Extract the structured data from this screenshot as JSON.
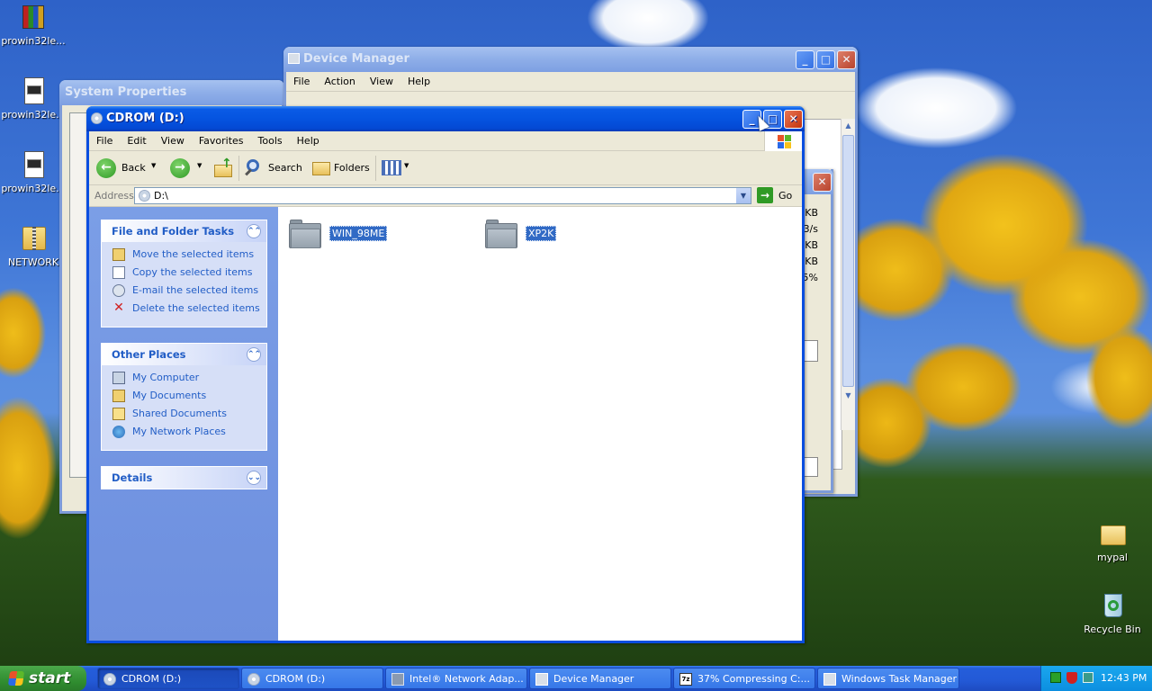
{
  "desktop": {
    "icons": [
      {
        "label": "prowin32le..."
      },
      {
        "label": "prowin32le..."
      },
      {
        "label": "prowin32le..."
      },
      {
        "label": "NETWORK"
      },
      {
        "label": "mypal"
      },
      {
        "label": "Recycle Bin"
      }
    ]
  },
  "system_properties": {
    "title": "System Properties"
  },
  "device_manager": {
    "title": "Device Manager",
    "menu": [
      "File",
      "Action",
      "View",
      "Help"
    ]
  },
  "background_dialog": {
    "stats": [
      "KB",
      "3/s",
      "KB",
      "KB",
      "5%"
    ]
  },
  "explorer": {
    "title": "CDROM (D:)",
    "menu": [
      "File",
      "Edit",
      "View",
      "Favorites",
      "Tools",
      "Help"
    ],
    "toolbar": {
      "back": "Back",
      "search": "Search",
      "folders": "Folders"
    },
    "address_label": "Address",
    "address_value": "D:\\",
    "go_label": "Go",
    "file_tasks": {
      "title": "File and Folder Tasks",
      "items": [
        "Move the selected items",
        "Copy the selected items",
        "E-mail the selected items",
        "Delete the selected items"
      ]
    },
    "other_places": {
      "title": "Other Places",
      "items": [
        "My Computer",
        "My Documents",
        "Shared Documents",
        "My Network Places"
      ]
    },
    "details": {
      "title": "Details"
    },
    "files": [
      {
        "name": "WIN_98ME",
        "selected": true
      },
      {
        "name": "XP2K",
        "selected": true
      }
    ]
  },
  "taskbar": {
    "start_label": "start",
    "items": [
      {
        "label": "CDROM (D:)",
        "active": true
      },
      {
        "label": "CDROM (D:)",
        "active": false
      },
      {
        "label": "Intel® Network Adap...",
        "active": false
      },
      {
        "label": "Device Manager",
        "active": false
      },
      {
        "label": "37% Compressing C:...",
        "active": false
      },
      {
        "label": "Windows Task Manager",
        "active": false
      }
    ],
    "clock": "12:43 PM"
  },
  "colors": {
    "title_blue": "#0554e0",
    "task_pane": "#6d8fdf",
    "link_blue": "#215dc6",
    "start_green": "#3c9a3c"
  }
}
